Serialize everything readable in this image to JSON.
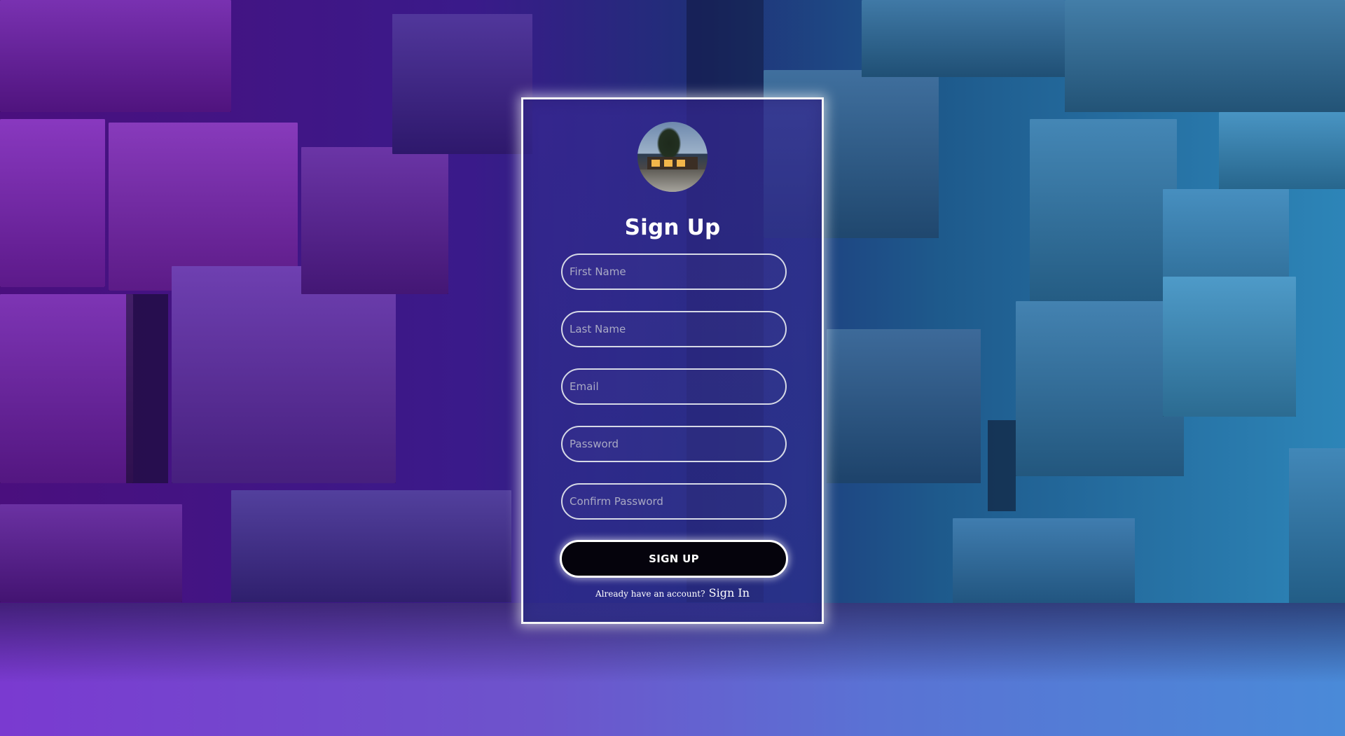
{
  "form": {
    "title": "Sign Up",
    "fields": [
      {
        "name": "first-name",
        "placeholder": "First Name",
        "value": ""
      },
      {
        "name": "last-name",
        "placeholder": "Last Name",
        "value": ""
      },
      {
        "name": "email",
        "placeholder": "Email",
        "value": ""
      },
      {
        "name": "password",
        "placeholder": "Password",
        "value": ""
      },
      {
        "name": "confirm-password",
        "placeholder": "Confirm Password",
        "value": ""
      }
    ],
    "submit_label": "SIGN UP",
    "prompt_text": "Already have an account?",
    "signin_link": "Sign In"
  },
  "colors": {
    "card_border": "#f4f4f6",
    "button_bg": "#05030c",
    "accent_purple": "#6a1aa8",
    "accent_blue": "#2d85b8"
  },
  "icons": {
    "avatar": "avatar-photo-house"
  }
}
